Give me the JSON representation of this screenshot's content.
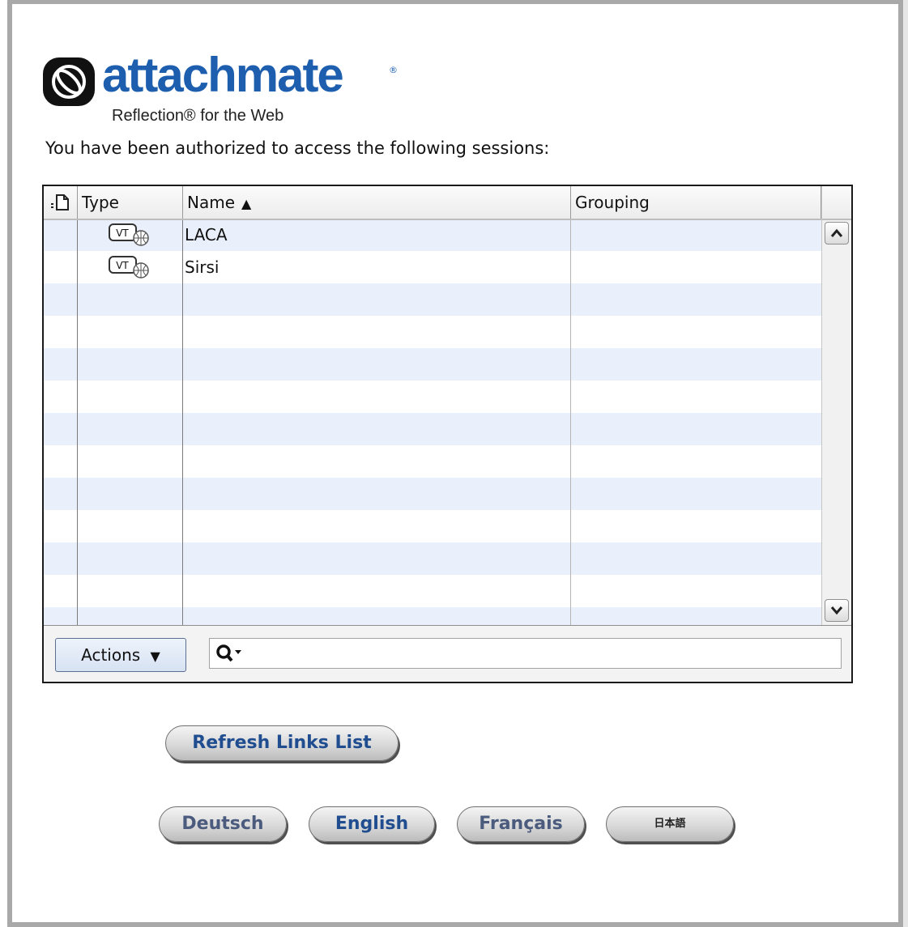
{
  "logo": {
    "brand": "attachmate",
    "reg_mark": "®",
    "product": "Reflection® for the Web"
  },
  "intro_text": "You have been authorized to access the following sessions:",
  "table": {
    "columns": {
      "status_icon": "page-icon",
      "type": "Type",
      "name": "Name",
      "grouping": "Grouping"
    },
    "sort_column": "Name",
    "sort_indicator": "▲",
    "rows": [
      {
        "type_icon": "vt-web-session-icon",
        "type_icon_text": "VT",
        "name": "LACA",
        "grouping": ""
      },
      {
        "type_icon": "vt-web-session-icon",
        "type_icon_text": "VT",
        "name": "Sirsi",
        "grouping": ""
      }
    ],
    "stripe_color": "#e9effb"
  },
  "scrollbar": {
    "up": "▲",
    "down": "▼"
  },
  "toolbar": {
    "actions_label": "Actions",
    "actions_arrow": "▼",
    "search_value": ""
  },
  "buttons": {
    "refresh": "Refresh Links List",
    "languages": [
      "Deutsch",
      "English",
      "Français",
      "日本語"
    ]
  },
  "colors": {
    "brand_blue": "#1d5fae",
    "frame_gray": "#a9a9a9"
  }
}
